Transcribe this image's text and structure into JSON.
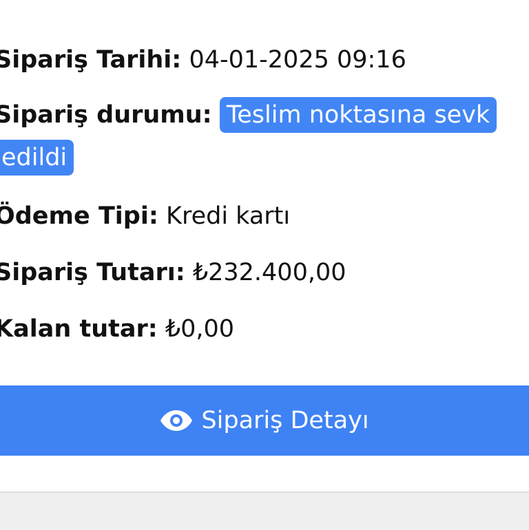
{
  "order": {
    "date_label": "Sipariş Tarihi:",
    "date_value": "04-01-2025 09:16",
    "status_label": "Sipariş durumu:",
    "status_value": "Teslim noktasına sevk edildi",
    "payment_label": "Ödeme Tipi:",
    "payment_value": "Kredi kartı",
    "total_label": "Sipariş Tutarı:",
    "total_value": "₺232.400,00",
    "remaining_label": "Kalan tutar:",
    "remaining_value": "₺0,00"
  },
  "actions": {
    "detail_label": "Sipariş Detayı",
    "detail_icon": "eye-icon"
  },
  "colors": {
    "accent": "#3f82f4",
    "badge": "#4286f5"
  }
}
